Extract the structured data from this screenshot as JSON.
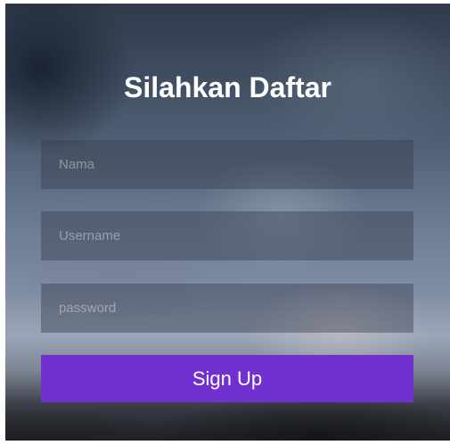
{
  "form": {
    "title": "Silahkan Daftar",
    "fields": {
      "name": {
        "placeholder": "Nama",
        "value": ""
      },
      "username": {
        "placeholder": "Username",
        "value": ""
      },
      "password": {
        "placeholder": "password",
        "value": ""
      }
    },
    "submit_label": "Sign Up"
  },
  "colors": {
    "button": "#7230d0",
    "title_text": "#ffffff"
  }
}
